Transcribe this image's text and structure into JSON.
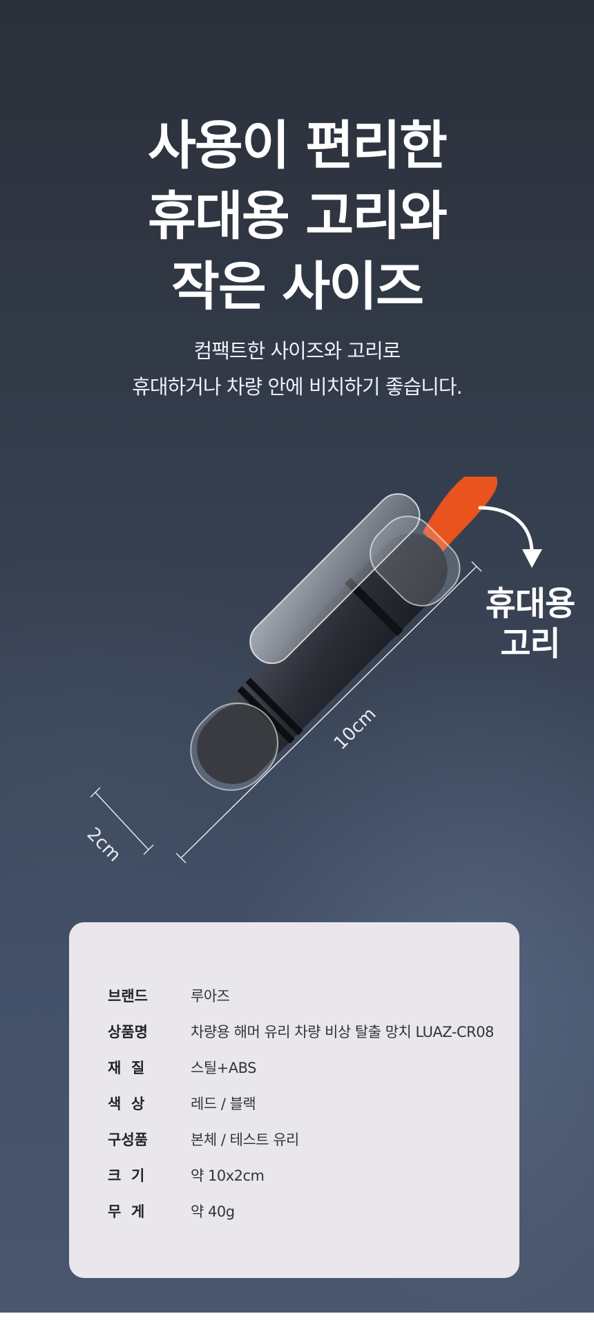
{
  "headline": {
    "line1": "사용이 편리한",
    "line2": "휴대용 고리와",
    "line3": "작은 사이즈"
  },
  "subtitle": {
    "line1": "컴팩트한 사이즈와 고리로",
    "line2": "휴대하거나 차량 안에 비치하기 좋습니다."
  },
  "product": {
    "strap_label_line1": "휴대용",
    "strap_label_line2": "고리",
    "length_label": "10cm",
    "width_label": "2cm",
    "strap_color": "#e8531e",
    "body_color": "#2d3038"
  },
  "specs": [
    {
      "label": "브랜드",
      "value": "루아즈"
    },
    {
      "label": "상품명",
      "value": "차량용 해머 유리 차량 비상 탈출 망치 LUAZ-CR08"
    },
    {
      "label": "재  질",
      "value": "스틸+ABS"
    },
    {
      "label": "색  상",
      "value": "레드 / 블랙"
    },
    {
      "label": "구성품",
      "value": "본체 / 테스트 유리"
    },
    {
      "label": "크  기",
      "value": "약 10x2cm"
    },
    {
      "label": "무  게",
      "value": "약 40g"
    }
  ]
}
